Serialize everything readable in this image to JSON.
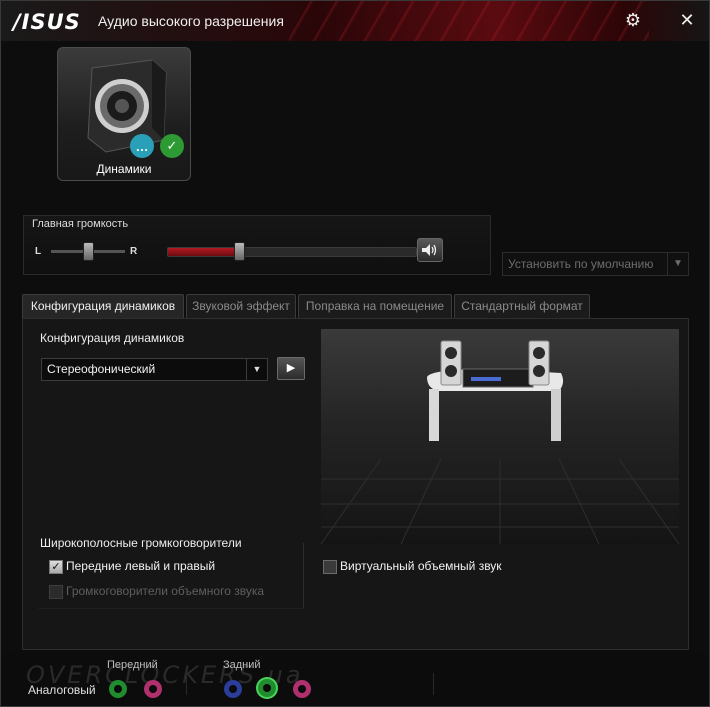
{
  "window": {
    "logo": "/ISUS",
    "title": "Аудио высокого разрешения"
  },
  "icons": {
    "settings": "gear-icon",
    "close": "close-icon"
  },
  "device": {
    "label": "Динамики"
  },
  "volume": {
    "title": "Главная громкость",
    "left_label": "L",
    "right_label": "R",
    "balance": 0.5,
    "level": 0.29
  },
  "default_button": {
    "label": "Установить по умолчанию"
  },
  "tabs": [
    {
      "label": "Конфигурация динамиков"
    },
    {
      "label": "Звуковой эффект"
    },
    {
      "label": "Поправка на помещение"
    },
    {
      "label": "Стандартный формат"
    }
  ],
  "config": {
    "label": "Конфигурация динамиков",
    "selected": "Стереофонический"
  },
  "wideband": {
    "title": "Широкополосные громкоговорители",
    "front": {
      "label": "Передние левый и правый",
      "checked": true
    },
    "surround": {
      "label": "Громкоговорители объемного звука",
      "checked": false
    }
  },
  "virtual_surround": {
    "label": "Виртуальный объемный звук",
    "checked": false
  },
  "footer": {
    "analog_label": "Аналоговый",
    "front_label": "Передний",
    "rear_label": "Задний",
    "watermark": "OVERCLOCKERS.ua"
  },
  "colors": {
    "accent_red": "#b41a22",
    "jack_green": "#1f8c2e",
    "jack_pink": "#b0306e",
    "jack_blue": "#2a3d9a"
  }
}
